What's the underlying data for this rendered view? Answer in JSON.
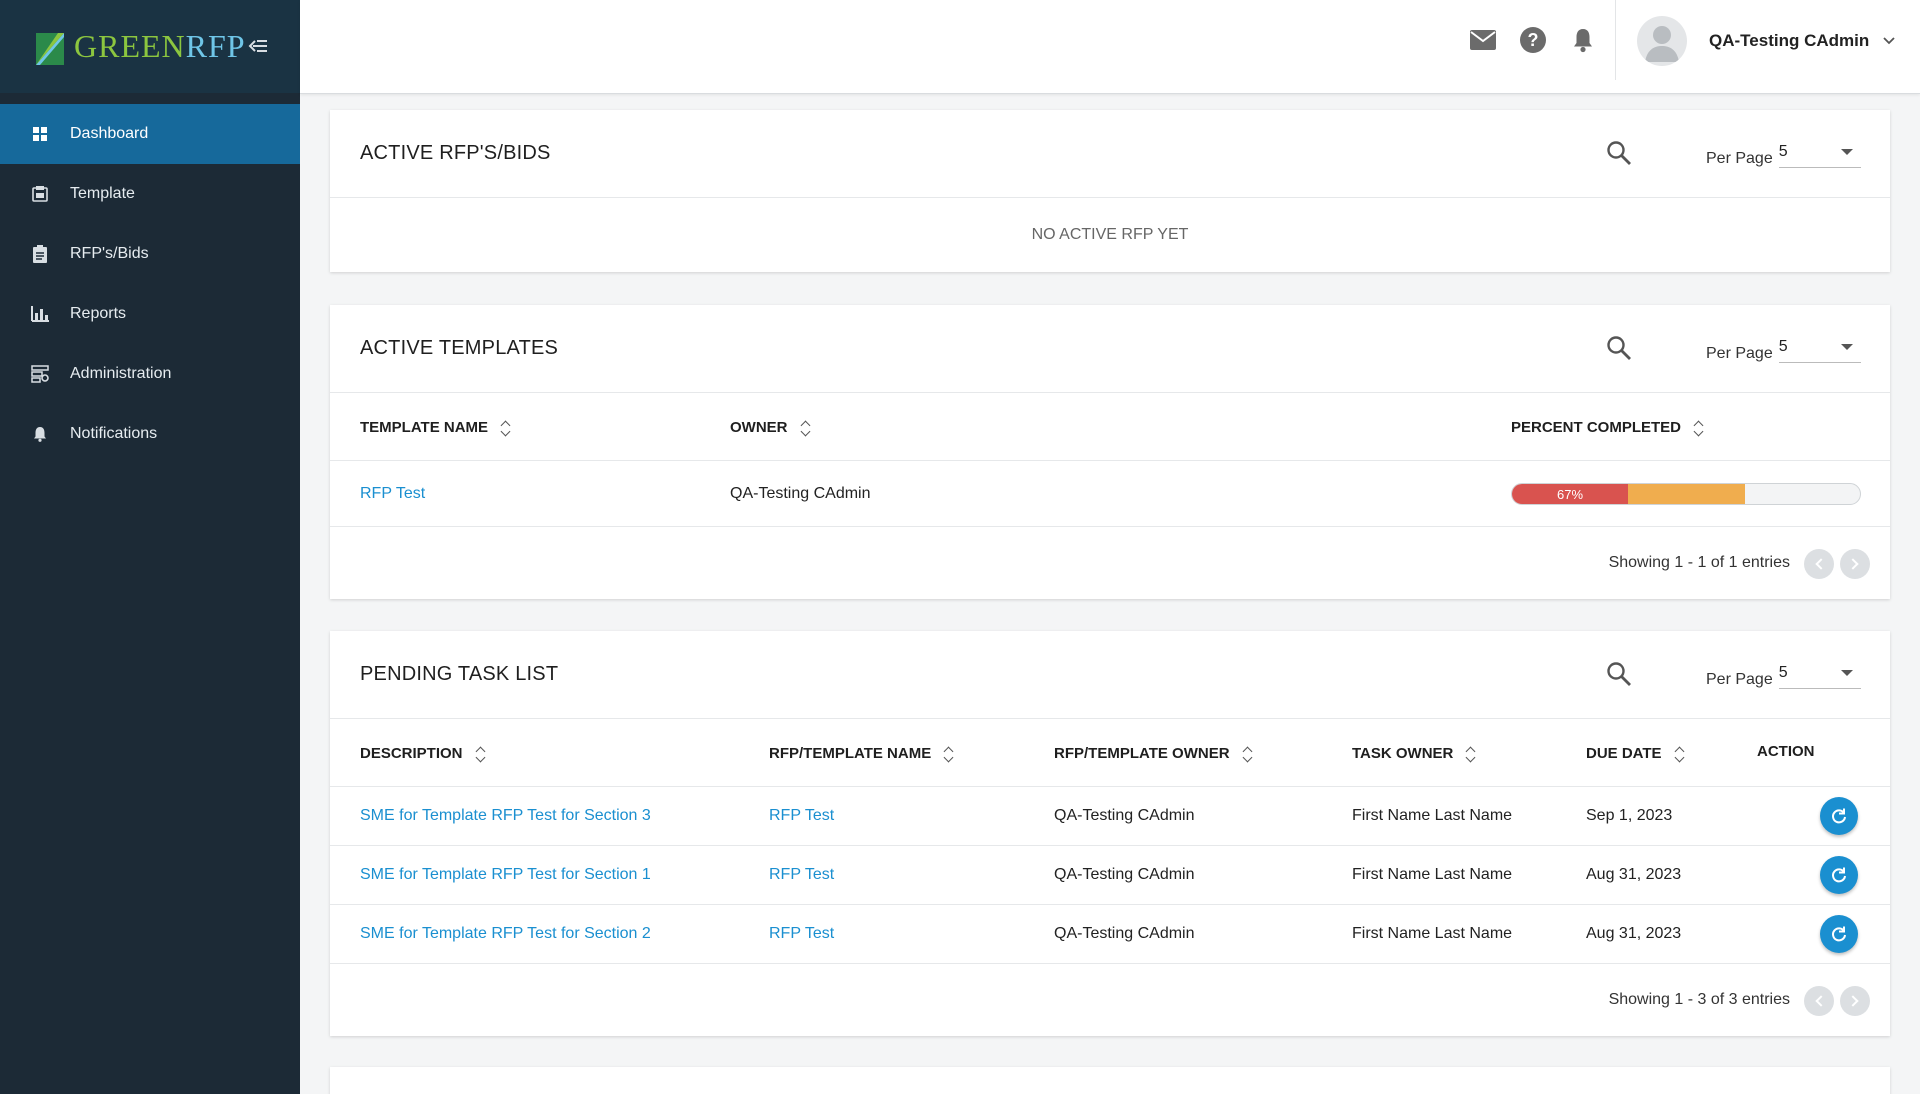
{
  "brand": {
    "name_part1": "GREEN",
    "name_part2": "RFP"
  },
  "sidebar": {
    "items": [
      {
        "label": "Dashboard",
        "icon": "dashboard-icon",
        "active": true
      },
      {
        "label": "Template",
        "icon": "template-icon"
      },
      {
        "label": "RFP's/Bids",
        "icon": "clipboard-icon"
      },
      {
        "label": "Reports",
        "icon": "bar-chart-icon"
      },
      {
        "label": "Administration",
        "icon": "admin-icon"
      },
      {
        "label": "Notifications",
        "icon": "bell-icon"
      }
    ]
  },
  "header": {
    "icons": [
      "mail-icon",
      "help-icon",
      "bell-icon"
    ],
    "user_name": "QA-Testing CAdmin"
  },
  "active_rfps": {
    "title": "ACTIVE RFP'S/BIDS",
    "per_page_label": "Per Page",
    "per_page_value": "5",
    "empty_text": "NO ACTIVE RFP YET"
  },
  "active_templates": {
    "title": "ACTIVE TEMPLATES",
    "per_page_label": "Per Page",
    "per_page_value": "5",
    "columns": [
      "TEMPLATE NAME",
      "OWNER",
      "PERCENT COMPLETED"
    ],
    "rows": [
      {
        "name": "RFP Test",
        "owner": "QA-Testing CAdmin",
        "percent_label": "67%",
        "percent": 67
      }
    ],
    "showing": "Showing 1 - 1 of 1 entries"
  },
  "pending_tasks": {
    "title": "PENDING TASK LIST",
    "per_page_label": "Per Page",
    "per_page_value": "5",
    "columns": [
      "DESCRIPTION",
      "RFP/TEMPLATE NAME",
      "RFP/TEMPLATE OWNER",
      "TASK OWNER",
      "DUE DATE",
      "ACTION"
    ],
    "rows": [
      {
        "description": "SME for Template RFP Test for Section 3",
        "name": "RFP Test",
        "owner": "QA-Testing CAdmin",
        "task_owner": "First Name Last Name",
        "due": "Sep 1, 2023"
      },
      {
        "description": "SME for Template RFP Test for Section 1",
        "name": "RFP Test",
        "owner": "QA-Testing CAdmin",
        "task_owner": "First Name Last Name",
        "due": "Aug 31, 2023"
      },
      {
        "description": "SME for Template RFP Test for Section 2",
        "name": "RFP Test",
        "owner": "QA-Testing CAdmin",
        "task_owner": "First Name Last Name",
        "due": "Aug 31, 2023"
      }
    ],
    "showing": "Showing 1 - 3 of 3 entries"
  },
  "colors": {
    "sidebar_bg": "#1c2a36",
    "active_nav": "#16699b",
    "link": "#1a8fd0",
    "progress_red": "#d9534f",
    "progress_orange": "#f0ad4e"
  }
}
